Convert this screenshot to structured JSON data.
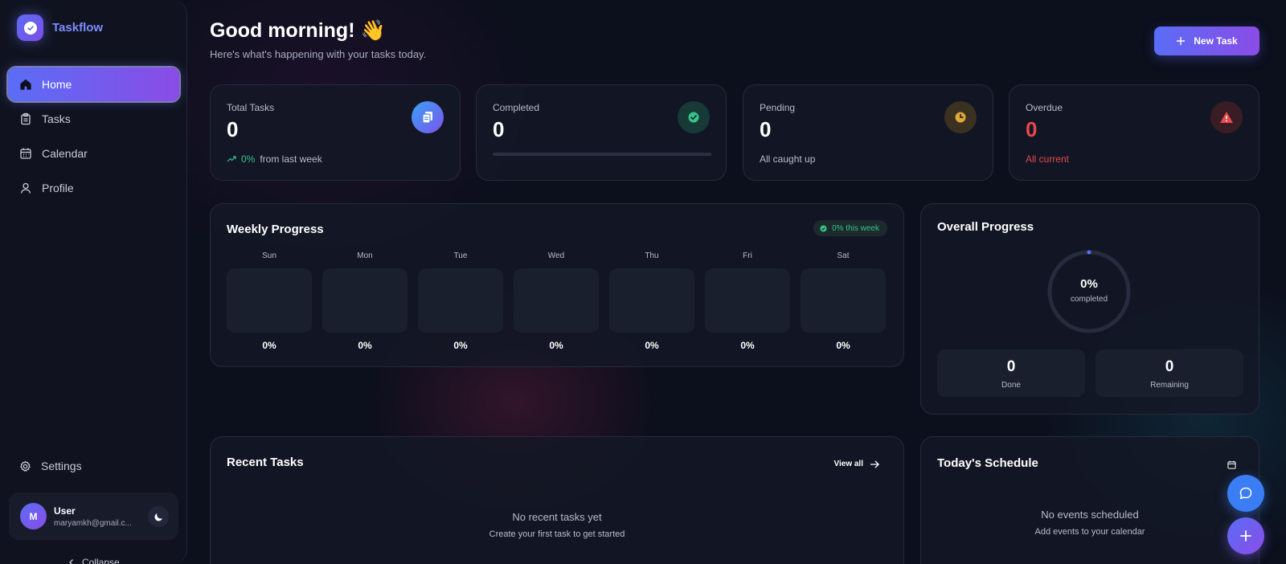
{
  "app": {
    "name": "Taskflow"
  },
  "sidebar": {
    "items": [
      {
        "label": "Home",
        "icon": "home-icon",
        "active": true
      },
      {
        "label": "Tasks",
        "icon": "clipboard-icon",
        "active": false
      },
      {
        "label": "Calendar",
        "icon": "calendar-icon",
        "active": false
      },
      {
        "label": "Profile",
        "icon": "user-icon",
        "active": false
      }
    ],
    "settings_label": "Settings",
    "user": {
      "initial": "M",
      "name": "User",
      "email": "maryamkh@gmail.c..."
    },
    "collapse_label": "Collapse"
  },
  "header": {
    "greeting": "Good morning! 👋",
    "subtitle": "Here's what's happening with your tasks today.",
    "new_task_label": "New Task"
  },
  "stats": {
    "total": {
      "label": "Total Tasks",
      "value": "0",
      "trend": "0%",
      "trend_note": "from last week"
    },
    "completed": {
      "label": "Completed",
      "value": "0",
      "progress": 0
    },
    "pending": {
      "label": "Pending",
      "value": "0",
      "note": "All caught up"
    },
    "overdue": {
      "label": "Overdue",
      "value": "0",
      "note": "All current"
    }
  },
  "weekly": {
    "title": "Weekly Progress",
    "badge": "0% this week",
    "days": [
      {
        "name": "Sun",
        "pct": "0%",
        "value": 0
      },
      {
        "name": "Mon",
        "pct": "0%",
        "value": 0
      },
      {
        "name": "Tue",
        "pct": "0%",
        "value": 0
      },
      {
        "name": "Wed",
        "pct": "0%",
        "value": 0
      },
      {
        "name": "Thu",
        "pct": "0%",
        "value": 0
      },
      {
        "name": "Fri",
        "pct": "0%",
        "value": 0
      },
      {
        "name": "Sat",
        "pct": "0%",
        "value": 0
      }
    ]
  },
  "overall": {
    "title": "Overall Progress",
    "pct": "0%",
    "caption": "completed",
    "value": 0,
    "done": {
      "value": "0",
      "label": "Done"
    },
    "remaining": {
      "value": "0",
      "label": "Remaining"
    }
  },
  "recent": {
    "title": "Recent Tasks",
    "view_all": "View all",
    "empty_title": "No recent tasks yet",
    "empty_sub": "Create your first task to get started"
  },
  "schedule": {
    "title": "Today's Schedule",
    "empty_title": "No events scheduled",
    "empty_sub": "Add events to your calendar"
  },
  "colors": {
    "accent_start": "#5a6df6",
    "accent_end": "#8a4ce6",
    "success": "#34c48b",
    "warning": "#e0a73a",
    "danger": "#e5484d"
  }
}
